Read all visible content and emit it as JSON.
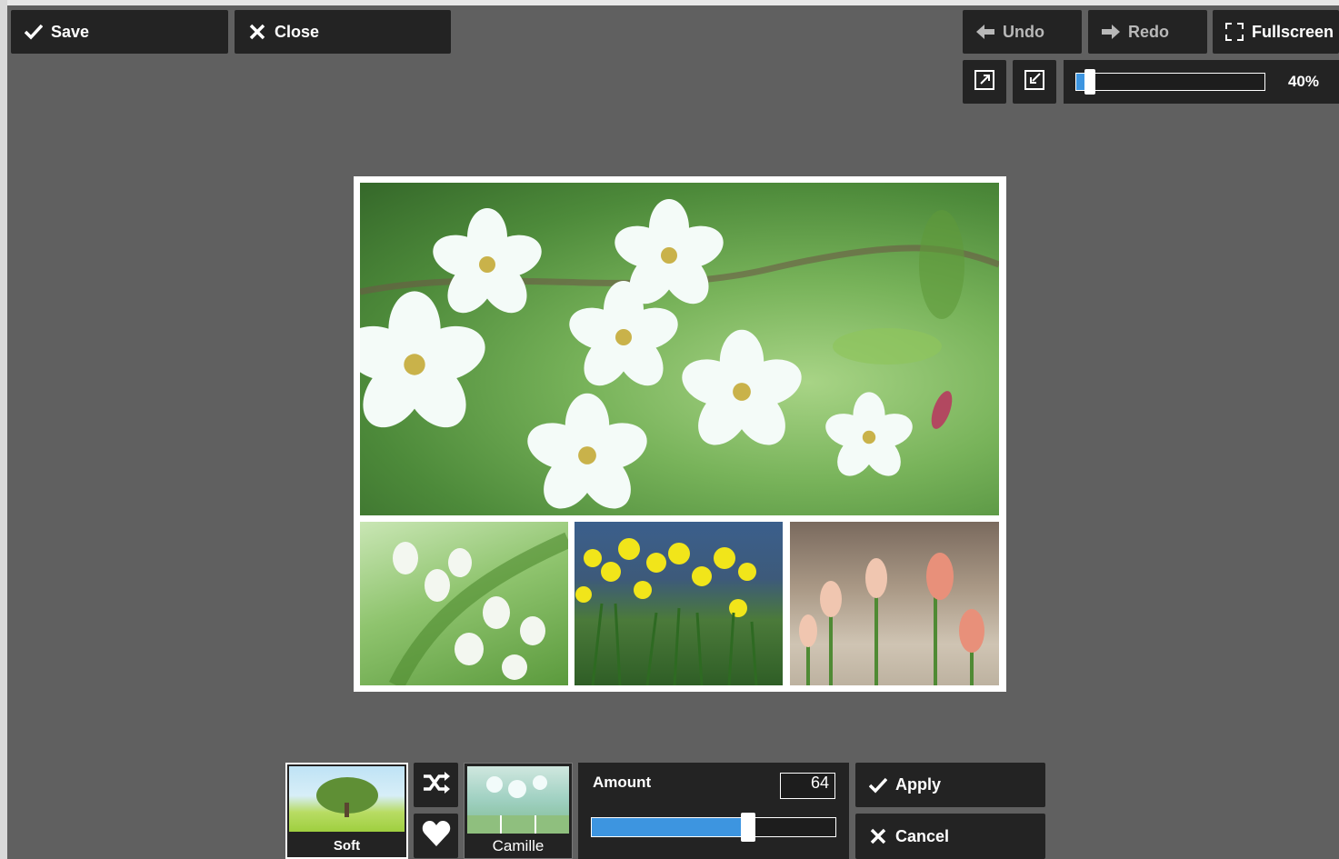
{
  "toolbar": {
    "save_label": "Save",
    "close_label": "Close",
    "undo_label": "Undo",
    "redo_label": "Redo",
    "fullscreen_label": "Fullscreen"
  },
  "zoom": {
    "value_label": "40%",
    "level_percent": 40
  },
  "canvas": {
    "photos": [
      "white-cherry-blossoms",
      "lily-of-the-valley",
      "yellow-daffodils",
      "tulip-buds"
    ]
  },
  "filter_panel": {
    "presets": [
      {
        "label": "Soft",
        "selected": true
      },
      {
        "label": "Camille",
        "selected": false
      }
    ],
    "shuffle_icon": "shuffle-icon",
    "favorite_icon": "heart-icon",
    "amount_label": "Amount",
    "amount_value": "64",
    "amount_level_percent": 64,
    "apply_label": "Apply",
    "cancel_label": "Cancel"
  },
  "colors": {
    "background": "#606060",
    "panel": "#232323",
    "accent": "#3d95e0"
  }
}
